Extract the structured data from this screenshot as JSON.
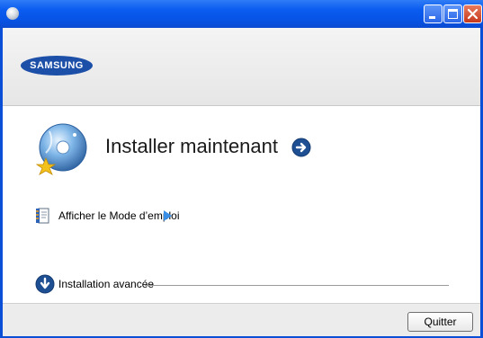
{
  "window": {
    "brand": "SAMSUNG",
    "colors": {
      "titlebar": "#0754e6",
      "brand_blue": "#1b4fa8",
      "link_arrow": "#3a8ee6"
    }
  },
  "main": {
    "install_now_label": "Installer maintenant",
    "manual_label": "Afficher le Mode d’emploi",
    "advanced_label": "Installation avancée"
  },
  "footer": {
    "quit_label": "Quitter"
  },
  "icons": {
    "app": "app-disc-icon",
    "install": "install-cd-icon",
    "install_go": "arrow-right-circle-icon",
    "manual": "manual-book-icon",
    "manual_go": "triangle-right-icon",
    "advanced": "arrow-down-circle-icon"
  }
}
